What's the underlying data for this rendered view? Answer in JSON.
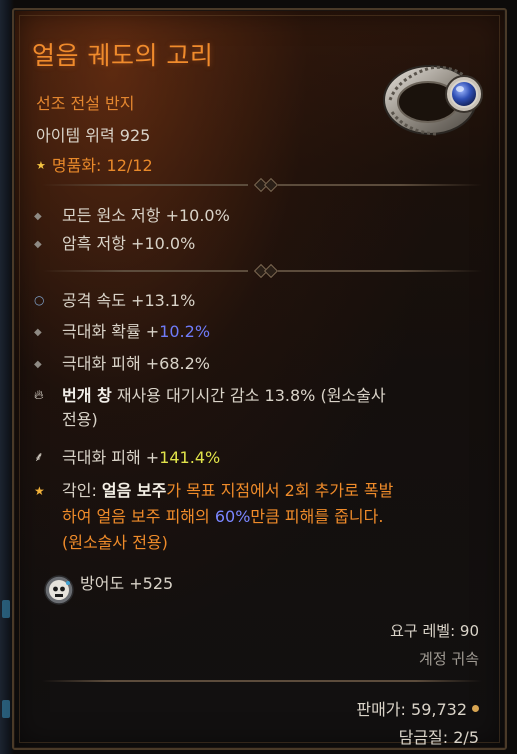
{
  "item": {
    "name": "얼음 궤도의 고리",
    "type": "선조 전설 반지",
    "power": "아이템 위력 925",
    "masterwork_label": "명품화:",
    "masterwork_value": "12/12"
  },
  "implicit_affixes": [
    {
      "text": "모든 원소 저항 +10.0%"
    },
    {
      "text": "암흑 저항 +10.0%"
    }
  ],
  "affixes": [
    {
      "text": "공격 속도 +13.1%",
      "bullet": "circle"
    },
    {
      "label": "극대화 확률 +",
      "value": "10.2%",
      "bullet": "diamond"
    },
    {
      "text": "극대화 피해 +68.2%",
      "bullet": "diamond"
    },
    {
      "bold": "번개 창",
      "text": " 재사용 대기시간 감소 13.8% (원소술사",
      "text2": "전용)",
      "bullet": "flame"
    },
    {
      "label": "극대화 피해 +",
      "value": "141.4%",
      "bullet": "rune"
    }
  ],
  "legendary": {
    "prefix": "각인: ",
    "power_name": "얼음 보주",
    "line1_rest": "가 목표 지점에서 2회 추가로 폭발",
    "line2a": "하여 얼음 보주 피해의 ",
    "line2_pct": "60%",
    "line2b": "만큼 피해를 줍니다.",
    "line3": "(원소술사 전용)"
  },
  "armor": {
    "text": "방어도 +525"
  },
  "footer": {
    "required_level": "요구 레벨: 90",
    "bound": "계정 귀속",
    "sell_price_label": "판매가:",
    "sell_price_value": "59,732",
    "temper_label": "담금질:",
    "temper_value": "2/5"
  },
  "colors": {
    "legendary_orange": "#ef8b2a",
    "greater_affix_blue": "#6f7bf7",
    "masterwork_yellow": "#e0e34a",
    "text_light": "#d9d3c8"
  },
  "icons": {
    "ring": "ring-item-icon",
    "armor": "armor-skull-icon",
    "coin": "gold-coin-icon"
  }
}
